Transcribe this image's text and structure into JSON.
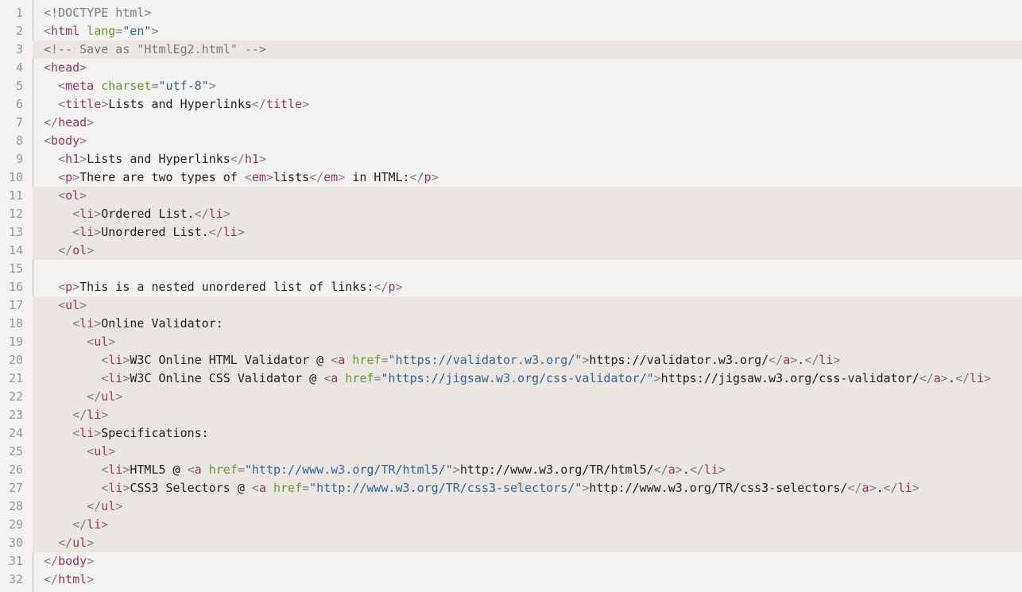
{
  "colors": {
    "background": "#f5f3f1",
    "highlight": "#ebe6e2",
    "tag": "#993366",
    "attribute": "#669933",
    "string": "#336699",
    "punctuation": "#7f7f7f",
    "comment": "#7b7b7b",
    "text": "#222222",
    "line_number": "#999999"
  },
  "lines": [
    {
      "n": "1",
      "hl": false,
      "indent": "",
      "tokens": [
        [
          "p",
          "<"
        ],
        [
          "c",
          "!DOCTYPE html"
        ],
        [
          "p",
          ">"
        ]
      ]
    },
    {
      "n": "2",
      "hl": false,
      "indent": "",
      "tokens": [
        [
          "p",
          "<"
        ],
        [
          "t",
          "html"
        ],
        [
          "x",
          " "
        ],
        [
          "a",
          "lang"
        ],
        [
          "p",
          "="
        ],
        [
          "s",
          "\"en\""
        ],
        [
          "p",
          ">"
        ]
      ]
    },
    {
      "n": "3",
      "hl": true,
      "indent": "",
      "tokens": [
        [
          "c",
          "<!-- Save as \"HtmlEg2.html\" -->"
        ]
      ]
    },
    {
      "n": "4",
      "hl": false,
      "indent": "",
      "tokens": [
        [
          "p",
          "<"
        ],
        [
          "t",
          "head"
        ],
        [
          "p",
          ">"
        ]
      ]
    },
    {
      "n": "5",
      "hl": false,
      "indent": "  ",
      "tokens": [
        [
          "p",
          "<"
        ],
        [
          "t",
          "meta"
        ],
        [
          "x",
          " "
        ],
        [
          "a",
          "charset"
        ],
        [
          "p",
          "="
        ],
        [
          "s",
          "\"utf-8\""
        ],
        [
          "p",
          ">"
        ]
      ]
    },
    {
      "n": "6",
      "hl": false,
      "indent": "  ",
      "tokens": [
        [
          "p",
          "<"
        ],
        [
          "t",
          "title"
        ],
        [
          "p",
          ">"
        ],
        [
          "x",
          "Lists and Hyperlinks"
        ],
        [
          "p",
          "</"
        ],
        [
          "t",
          "title"
        ],
        [
          "p",
          ">"
        ]
      ]
    },
    {
      "n": "7",
      "hl": false,
      "indent": "",
      "tokens": [
        [
          "p",
          "</"
        ],
        [
          "t",
          "head"
        ],
        [
          "p",
          ">"
        ]
      ]
    },
    {
      "n": "8",
      "hl": false,
      "indent": "",
      "tokens": [
        [
          "p",
          "<"
        ],
        [
          "t",
          "body"
        ],
        [
          "p",
          ">"
        ]
      ]
    },
    {
      "n": "9",
      "hl": false,
      "indent": "  ",
      "tokens": [
        [
          "p",
          "<"
        ],
        [
          "t",
          "h1"
        ],
        [
          "p",
          ">"
        ],
        [
          "x",
          "Lists and Hyperlinks"
        ],
        [
          "p",
          "</"
        ],
        [
          "t",
          "h1"
        ],
        [
          "p",
          ">"
        ]
      ]
    },
    {
      "n": "10",
      "hl": false,
      "indent": "  ",
      "tokens": [
        [
          "p",
          "<"
        ],
        [
          "t",
          "p"
        ],
        [
          "p",
          ">"
        ],
        [
          "x",
          "There are two types of "
        ],
        [
          "p",
          "<"
        ],
        [
          "t",
          "em"
        ],
        [
          "p",
          ">"
        ],
        [
          "x",
          "lists"
        ],
        [
          "p",
          "</"
        ],
        [
          "t",
          "em"
        ],
        [
          "p",
          ">"
        ],
        [
          "x",
          " in HTML:"
        ],
        [
          "p",
          "</"
        ],
        [
          "t",
          "p"
        ],
        [
          "p",
          ">"
        ]
      ]
    },
    {
      "n": "11",
      "hl": true,
      "indent": "  ",
      "tokens": [
        [
          "p",
          "<"
        ],
        [
          "t",
          "ol"
        ],
        [
          "p",
          ">"
        ]
      ]
    },
    {
      "n": "12",
      "hl": true,
      "indent": "    ",
      "tokens": [
        [
          "p",
          "<"
        ],
        [
          "t",
          "li"
        ],
        [
          "p",
          ">"
        ],
        [
          "x",
          "Ordered List."
        ],
        [
          "p",
          "</"
        ],
        [
          "t",
          "li"
        ],
        [
          "p",
          ">"
        ]
      ]
    },
    {
      "n": "13",
      "hl": true,
      "indent": "    ",
      "tokens": [
        [
          "p",
          "<"
        ],
        [
          "t",
          "li"
        ],
        [
          "p",
          ">"
        ],
        [
          "x",
          "Unordered List."
        ],
        [
          "p",
          "</"
        ],
        [
          "t",
          "li"
        ],
        [
          "p",
          ">"
        ]
      ]
    },
    {
      "n": "14",
      "hl": true,
      "indent": "  ",
      "tokens": [
        [
          "p",
          "</"
        ],
        [
          "t",
          "ol"
        ],
        [
          "p",
          ">"
        ]
      ]
    },
    {
      "n": "15",
      "hl": false,
      "indent": "",
      "tokens": []
    },
    {
      "n": "16",
      "hl": false,
      "indent": "  ",
      "tokens": [
        [
          "p",
          "<"
        ],
        [
          "t",
          "p"
        ],
        [
          "p",
          ">"
        ],
        [
          "x",
          "This is a nested unordered list of links:"
        ],
        [
          "p",
          "</"
        ],
        [
          "t",
          "p"
        ],
        [
          "p",
          ">"
        ]
      ]
    },
    {
      "n": "17",
      "hl": true,
      "indent": "  ",
      "tokens": [
        [
          "p",
          "<"
        ],
        [
          "t",
          "ul"
        ],
        [
          "p",
          ">"
        ]
      ]
    },
    {
      "n": "18",
      "hl": true,
      "indent": "    ",
      "tokens": [
        [
          "p",
          "<"
        ],
        [
          "t",
          "li"
        ],
        [
          "p",
          ">"
        ],
        [
          "x",
          "Online Validator:"
        ]
      ]
    },
    {
      "n": "19",
      "hl": true,
      "indent": "      ",
      "tokens": [
        [
          "p",
          "<"
        ],
        [
          "t",
          "ul"
        ],
        [
          "p",
          ">"
        ]
      ]
    },
    {
      "n": "20",
      "hl": true,
      "indent": "        ",
      "tokens": [
        [
          "p",
          "<"
        ],
        [
          "t",
          "li"
        ],
        [
          "p",
          ">"
        ],
        [
          "x",
          "W3C Online HTML Validator @ "
        ],
        [
          "p",
          "<"
        ],
        [
          "t",
          "a"
        ],
        [
          "x",
          " "
        ],
        [
          "a",
          "href"
        ],
        [
          "p",
          "="
        ],
        [
          "s",
          "\"https://validator.w3.org/\""
        ],
        [
          "p",
          ">"
        ],
        [
          "x",
          "https://validator.w3.org/"
        ],
        [
          "p",
          "</"
        ],
        [
          "t",
          "a"
        ],
        [
          "p",
          ">"
        ],
        [
          "x",
          "."
        ],
        [
          "p",
          "</"
        ],
        [
          "t",
          "li"
        ],
        [
          "p",
          ">"
        ]
      ]
    },
    {
      "n": "21",
      "hl": true,
      "indent": "        ",
      "tokens": [
        [
          "p",
          "<"
        ],
        [
          "t",
          "li"
        ],
        [
          "p",
          ">"
        ],
        [
          "x",
          "W3C Online CSS Validator @ "
        ],
        [
          "p",
          "<"
        ],
        [
          "t",
          "a"
        ],
        [
          "x",
          " "
        ],
        [
          "a",
          "href"
        ],
        [
          "p",
          "="
        ],
        [
          "s",
          "\"https://jigsaw.w3.org/css-validator/\""
        ],
        [
          "p",
          ">"
        ],
        [
          "x",
          "https://jigsaw.w3.org/css-validator/"
        ],
        [
          "p",
          "</"
        ],
        [
          "t",
          "a"
        ],
        [
          "p",
          ">"
        ],
        [
          "x",
          "."
        ],
        [
          "p",
          "</"
        ],
        [
          "t",
          "li"
        ],
        [
          "p",
          ">"
        ]
      ]
    },
    {
      "n": "22",
      "hl": true,
      "indent": "      ",
      "tokens": [
        [
          "p",
          "</"
        ],
        [
          "t",
          "ul"
        ],
        [
          "p",
          ">"
        ]
      ]
    },
    {
      "n": "23",
      "hl": true,
      "indent": "    ",
      "tokens": [
        [
          "p",
          "</"
        ],
        [
          "t",
          "li"
        ],
        [
          "p",
          ">"
        ]
      ]
    },
    {
      "n": "24",
      "hl": true,
      "indent": "    ",
      "tokens": [
        [
          "p",
          "<"
        ],
        [
          "t",
          "li"
        ],
        [
          "p",
          ">"
        ],
        [
          "x",
          "Specifications:"
        ]
      ]
    },
    {
      "n": "25",
      "hl": true,
      "indent": "      ",
      "tokens": [
        [
          "p",
          "<"
        ],
        [
          "t",
          "ul"
        ],
        [
          "p",
          ">"
        ]
      ]
    },
    {
      "n": "26",
      "hl": true,
      "indent": "        ",
      "tokens": [
        [
          "p",
          "<"
        ],
        [
          "t",
          "li"
        ],
        [
          "p",
          ">"
        ],
        [
          "x",
          "HTML5 @ "
        ],
        [
          "p",
          "<"
        ],
        [
          "t",
          "a"
        ],
        [
          "x",
          " "
        ],
        [
          "a",
          "href"
        ],
        [
          "p",
          "="
        ],
        [
          "s",
          "\"http://www.w3.org/TR/html5/\""
        ],
        [
          "p",
          ">"
        ],
        [
          "x",
          "http://www.w3.org/TR/html5/"
        ],
        [
          "p",
          "</"
        ],
        [
          "t",
          "a"
        ],
        [
          "p",
          ">"
        ],
        [
          "x",
          "."
        ],
        [
          "p",
          "</"
        ],
        [
          "t",
          "li"
        ],
        [
          "p",
          ">"
        ]
      ]
    },
    {
      "n": "27",
      "hl": true,
      "indent": "        ",
      "tokens": [
        [
          "p",
          "<"
        ],
        [
          "t",
          "li"
        ],
        [
          "p",
          ">"
        ],
        [
          "x",
          "CSS3 Selectors @ "
        ],
        [
          "p",
          "<"
        ],
        [
          "t",
          "a"
        ],
        [
          "x",
          " "
        ],
        [
          "a",
          "href"
        ],
        [
          "p",
          "="
        ],
        [
          "s",
          "\"http://www.w3.org/TR/css3-selectors/\""
        ],
        [
          "p",
          ">"
        ],
        [
          "x",
          "http://www.w3.org/TR/css3-selectors/"
        ],
        [
          "p",
          "</"
        ],
        [
          "t",
          "a"
        ],
        [
          "p",
          ">"
        ],
        [
          "x",
          "."
        ],
        [
          "p",
          "</"
        ],
        [
          "t",
          "li"
        ],
        [
          "p",
          ">"
        ]
      ]
    },
    {
      "n": "28",
      "hl": true,
      "indent": "      ",
      "tokens": [
        [
          "p",
          "</"
        ],
        [
          "t",
          "ul"
        ],
        [
          "p",
          ">"
        ]
      ]
    },
    {
      "n": "29",
      "hl": true,
      "indent": "    ",
      "tokens": [
        [
          "p",
          "</"
        ],
        [
          "t",
          "li"
        ],
        [
          "p",
          ">"
        ]
      ]
    },
    {
      "n": "30",
      "hl": true,
      "indent": "  ",
      "tokens": [
        [
          "p",
          "</"
        ],
        [
          "t",
          "ul"
        ],
        [
          "p",
          ">"
        ]
      ]
    },
    {
      "n": "31",
      "hl": false,
      "indent": "",
      "tokens": [
        [
          "p",
          "</"
        ],
        [
          "t",
          "body"
        ],
        [
          "p",
          ">"
        ]
      ]
    },
    {
      "n": "32",
      "hl": false,
      "indent": "",
      "tokens": [
        [
          "p",
          "</"
        ],
        [
          "t",
          "html"
        ],
        [
          "p",
          ">"
        ]
      ]
    }
  ]
}
